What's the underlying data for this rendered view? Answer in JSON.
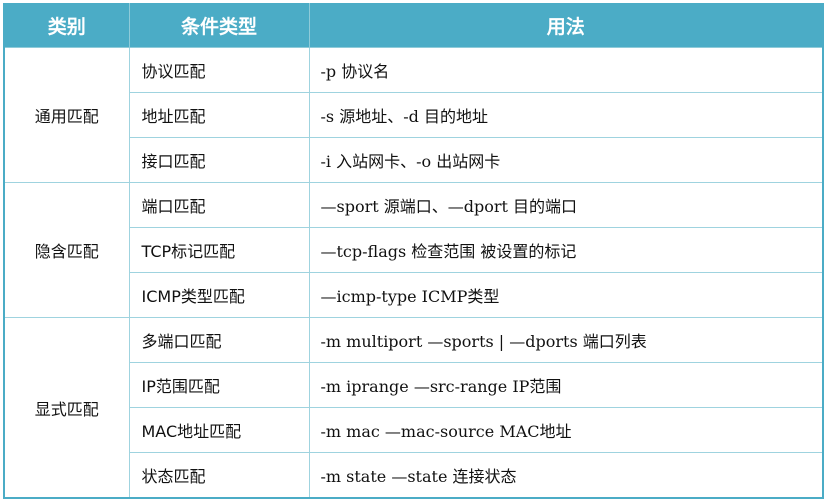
{
  "header": {
    "category": "类别",
    "condition_type": "条件类型",
    "usage": "用法"
  },
  "groups": [
    {
      "category": "通用匹配",
      "rows": [
        {
          "type": "协议匹配",
          "usage": "-p 协议名"
        },
        {
          "type": "地址匹配",
          "usage": "-s 源地址、-d 目的地址"
        },
        {
          "type": "接口匹配",
          "usage": "-i 入站网卡、-o 出站网卡"
        }
      ]
    },
    {
      "category": "隐含匹配",
      "rows": [
        {
          "type": "端口匹配",
          "usage": "—sport 源端口、—dport 目的端口"
        },
        {
          "type": "TCP标记匹配",
          "usage": "—tcp-flags 检查范围 被设置的标记"
        },
        {
          "type": "ICMP类型匹配",
          "usage": "—icmp-type ICMP类型"
        }
      ]
    },
    {
      "category": "显式匹配",
      "rows": [
        {
          "type": "多端口匹配",
          "usage": "-m multiport —sports | —dports 端口列表"
        },
        {
          "type": "IP范围匹配",
          "usage": "-m iprange —src-range IP范围"
        },
        {
          "type": "MAC地址匹配",
          "usage": "-m mac —mac-source MAC地址"
        },
        {
          "type": "状态匹配",
          "usage": "-m state —state 连接状态"
        }
      ]
    }
  ]
}
